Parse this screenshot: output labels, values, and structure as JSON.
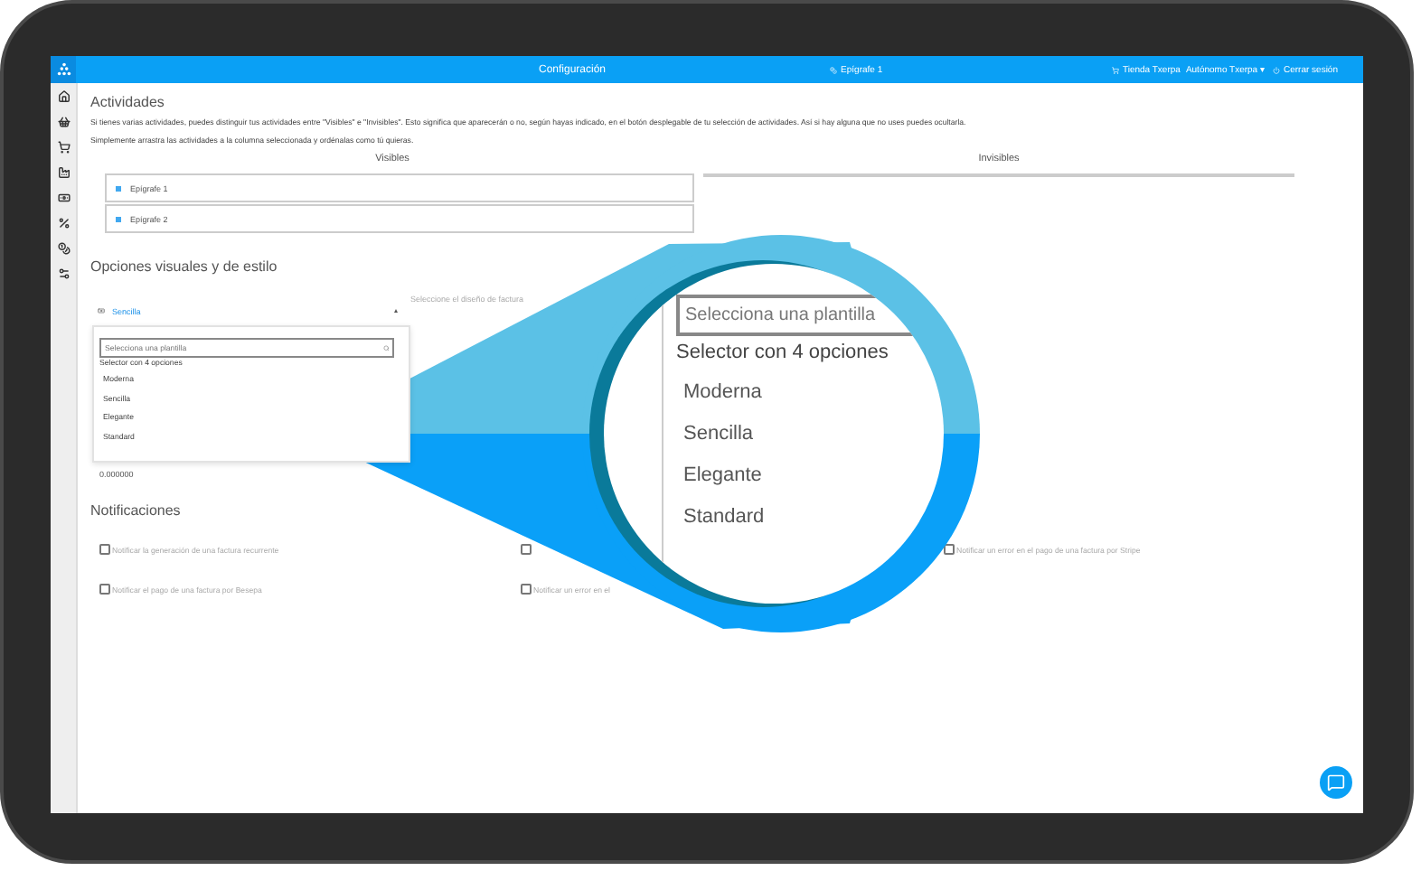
{
  "topbar": {
    "title": "Configuración",
    "current_activity": "Epígrafe 1",
    "store": "Tienda Txerpa",
    "user": "Autónomo Txerpa ▾",
    "logout": "Cerrar sesión"
  },
  "activities": {
    "title": "Actividades",
    "intro": "Si tienes varias actividades, puedes distinguir tus actividades entre \"Visibles\" e \"Invisibles\". Esto significa que aparecerán o no, según hayas indicado, en el botón desplegable de tu selección de actividades. Así si hay alguna que no uses puedes ocultarla.",
    "hint": "Simplemente arrastra las actividades a la columna seleccionada y ordénalas como tú quieras.",
    "visible": {
      "heading": "Visibles",
      "items": [
        "Epígrafe 1",
        "Epígrafe 2"
      ]
    },
    "invisible": {
      "heading": "Invisibles"
    }
  },
  "style_options": {
    "title": "Opciones visuales y de estilo",
    "template_select": {
      "value": "Sencilla",
      "expanded": true
    },
    "design_label": "Seleccione el diseño de factura",
    "dropdown": {
      "placeholder": "Selecciona una plantilla",
      "count": "Selector con 4 opciones",
      "options": [
        "Moderna",
        "Sencilla",
        "Elegante",
        "Standard"
      ]
    },
    "price_value": "0.000000"
  },
  "notifications": {
    "title": "Notificaciones",
    "items": [
      {
        "label": "Notificar la generación de una factura recurrente",
        "checked": false
      },
      {
        "checked": false
      },
      {
        "label": "Notificar un error en el pago de una factura por Stripe",
        "checked": false
      },
      {
        "label": "Notificar el pago de una factura por Besepa",
        "checked": false
      },
      {
        "label": "Notificar un error en el",
        "checked": false
      }
    ]
  },
  "magnifier": {
    "placeholder": "Selecciona una plantilla",
    "count": "Selector con 4 opciones",
    "options": [
      "Moderna",
      "Sencilla",
      "Elegante",
      "Standard"
    ]
  }
}
